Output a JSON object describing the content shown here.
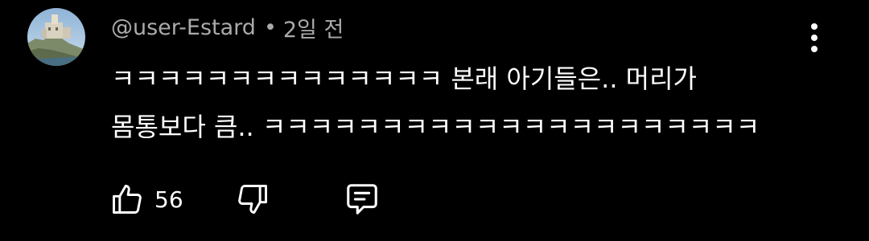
{
  "comment": {
    "author_handle": "@user-Estard",
    "separator": "•",
    "timestamp": "2일 전",
    "text_line_1": "ㅋㅋㅋㅋㅋㅋㅋㅋㅋㅋㅋㅋㅋㅋ 본래 아기들은.. 머리가",
    "text_line_2": "몸통보다 큼.. ㅋㅋㅋㅋㅋㅋㅋㅋㅋㅋㅋㅋㅋㅋㅋㅋㅋㅋㅋㅋㅋ",
    "like_count": "56"
  },
  "icons": {
    "avatar": "avatar-castle-photo",
    "more": "more-vertical-icon",
    "like": "thumbs-up-icon",
    "dislike": "thumbs-down-icon",
    "reply": "reply-comment-icon"
  },
  "colors": {
    "background": "#000000",
    "primary_text": "#ffffff",
    "secondary_text": "#aaaaaa"
  }
}
